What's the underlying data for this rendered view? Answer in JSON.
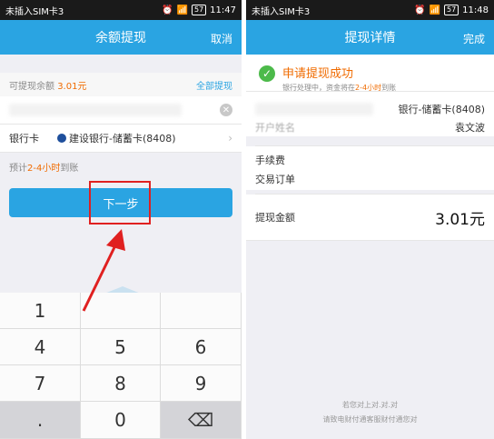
{
  "left": {
    "status": {
      "carrier": "未插入SIM卡3",
      "battery": "57",
      "time": "11:47"
    },
    "nav": {
      "title": "余额提现",
      "action": "取消"
    },
    "balance": {
      "label": "可提现余额",
      "amount": "3.01元",
      "all_link": "全部提现"
    },
    "input": {
      "clear": "✕"
    },
    "bank": {
      "label": "银行卡",
      "value": "建设银行-储蓄卡(8408)"
    },
    "eta": {
      "prefix": "预计",
      "highlight": "2-4小时",
      "suffix": "到账"
    },
    "next_button": "下一步",
    "keypad": {
      "keys": [
        {
          "label": "1"
        },
        {
          "label": ""
        },
        {
          "label": ""
        },
        {
          "label": "4"
        },
        {
          "label": "5"
        },
        {
          "label": "6"
        },
        {
          "label": "7"
        },
        {
          "label": "8"
        },
        {
          "label": "9"
        },
        {
          "label": "."
        },
        {
          "label": "0"
        },
        {
          "label": "⌫"
        }
      ]
    }
  },
  "right": {
    "status": {
      "carrier": "未插入SIM卡3",
      "battery": "57",
      "time": "11:48"
    },
    "nav": {
      "title": "提现详情",
      "action": "完成"
    },
    "success": {
      "title": "申请提现成功",
      "sub_prefix": "银行处理中，资金将在",
      "sub_highlight": "2-4小时",
      "sub_suffix": "到账"
    },
    "rows": {
      "bank_value": "银行-储蓄卡(8408)",
      "holder_label": "开户姓名",
      "holder_value": "袁文波",
      "fee_label": "手续费",
      "order_label": "交易订单",
      "amount_label": "提现金额",
      "amount_value": "3.01元"
    },
    "footer": {
      "line1": "若您对上对.对.对",
      "line2": "请致电财付通客服财付通您对"
    }
  },
  "colors": {
    "accent": "#2aa4e2",
    "highlight": "#f06b00",
    "success": "#4cba4a",
    "annotation": "#e02020"
  }
}
